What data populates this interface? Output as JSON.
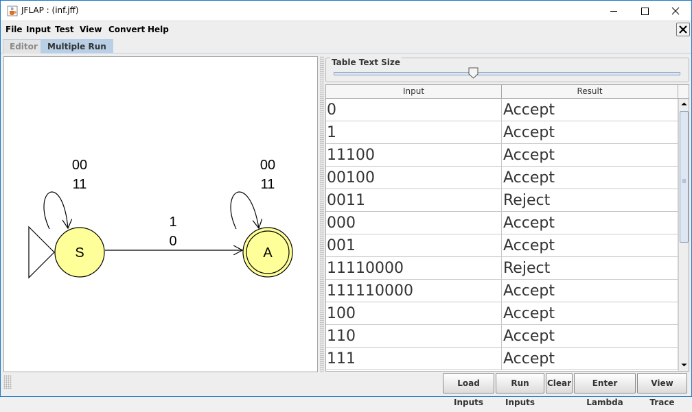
{
  "window": {
    "title": "JFLAP : (inf.jff)",
    "icon": "java-cup-icon",
    "controls": [
      "minimize-icon",
      "maximize-icon",
      "close-icon"
    ]
  },
  "menu": {
    "items": [
      "File",
      "Input",
      "Test",
      "View",
      "Convert",
      "Help"
    ],
    "close_icon": "close-icon"
  },
  "tabs": [
    {
      "label": "Editor",
      "selected": false
    },
    {
      "label": "Multiple Run",
      "selected": true
    }
  ],
  "automaton": {
    "states": [
      {
        "label": "S",
        "initial": true,
        "final": false
      },
      {
        "label": "A",
        "initial": false,
        "final": true
      }
    ],
    "transitions": [
      {
        "from": "S",
        "to": "S",
        "labels": [
          "00",
          "11"
        ]
      },
      {
        "from": "A",
        "to": "A",
        "labels": [
          "00",
          "11"
        ]
      },
      {
        "from": "S",
        "to": "A",
        "labels": [
          "1",
          "0"
        ]
      }
    ],
    "state_fill": "#ffff99"
  },
  "table_size": {
    "label": "Table Text Size",
    "level": 0.4
  },
  "table": {
    "columns": [
      "Input",
      "Result"
    ],
    "rows": [
      {
        "input": "0",
        "result": "Accept"
      },
      {
        "input": "1",
        "result": "Accept"
      },
      {
        "input": "11100",
        "result": "Accept"
      },
      {
        "input": "00100",
        "result": "Accept"
      },
      {
        "input": "0011",
        "result": "Reject"
      },
      {
        "input": "000",
        "result": "Accept"
      },
      {
        "input": "001",
        "result": "Accept"
      },
      {
        "input": "11110000",
        "result": "Reject"
      },
      {
        "input": "111110000",
        "result": "Accept"
      },
      {
        "input": "100",
        "result": "Accept"
      },
      {
        "input": "110",
        "result": "Accept"
      },
      {
        "input": "111",
        "result": "Accept"
      }
    ]
  },
  "buttons": {
    "load_inputs": "Load Inputs",
    "run_inputs": "Run Inputs",
    "clear": "Clear",
    "enter_lambda": "Enter Lambda",
    "view_trace": "View Trace"
  }
}
